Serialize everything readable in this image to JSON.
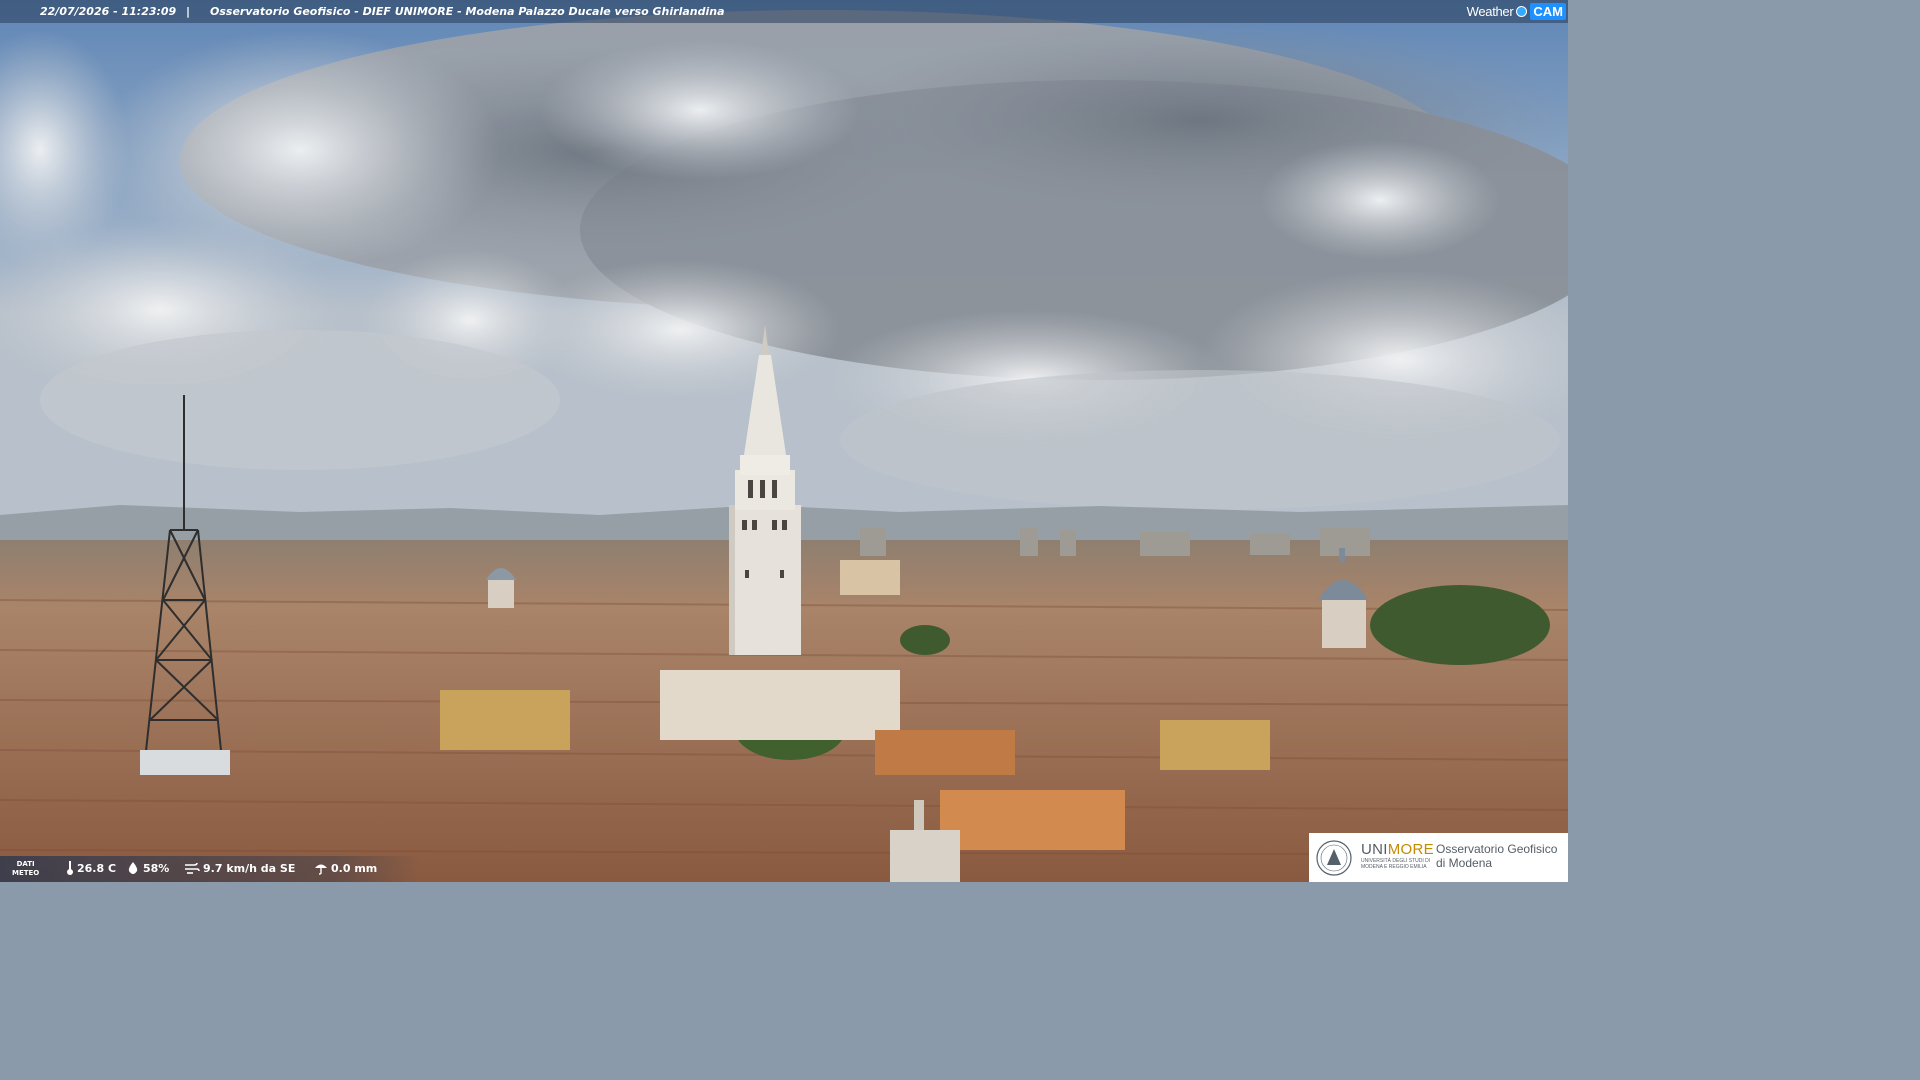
{
  "header": {
    "datetime": "22/07/2026 - 11:23:09",
    "separator": "|",
    "title": "Osservatorio Geofisico - DIEF UNIMORE - Modena Palazzo Ducale verso Ghirlandina",
    "brand": {
      "weather": "Weather",
      "cam": "CAM"
    }
  },
  "meteo": {
    "label_line1": "DATI",
    "label_line2": "METEO",
    "temperature": "26.8 C",
    "humidity": "58%",
    "wind": "9.7 km/h da SE",
    "rain": "0.0 mm",
    "icons": [
      "thermometer-icon",
      "humidity-drop-icon",
      "wind-icon",
      "rain-umbrella-icon"
    ]
  },
  "logo": {
    "unimore_1": "UNI",
    "unimore_2": "MORE",
    "university_line1": "UNIVERSITÀ DEGLI STUDI DI",
    "university_line2": "MODENA E REGGIO EMILIA",
    "observatory_line1": "Osservatorio Geofisico",
    "observatory_line2": "di Modena"
  },
  "colors": {
    "sky_top": "#6f93bd",
    "cloud_light": "#e6e8eb",
    "cloud_dark": "#7c838d",
    "roofs": "#a8765a",
    "tower": "#e9e6e0",
    "accent_brand": "#1e90ff",
    "unimore_gold": "#c48a00"
  }
}
